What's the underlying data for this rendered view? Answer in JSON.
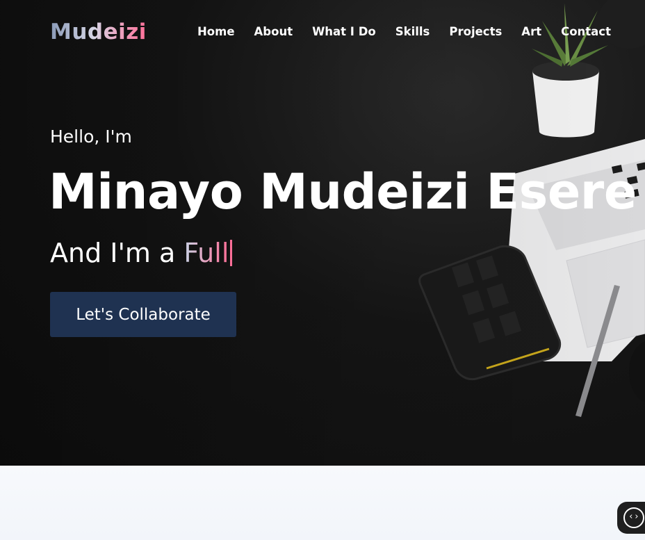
{
  "nav": {
    "logo": "Mudeizi",
    "items": [
      "Home",
      "About",
      "What I Do",
      "Skills",
      "Projects",
      "Art",
      "Contact"
    ]
  },
  "hero": {
    "greeting": "Hello, I'm",
    "name": "Minayo Mudeizi Esere",
    "role_prefix": "And I'm a ",
    "role_typed": "Full",
    "cta": "Let's Collaborate"
  },
  "icons": {
    "code_search": "code-search-icon"
  },
  "colors": {
    "button_bg": "#1f3251",
    "accent_pink": "#ff6f98",
    "hero_bg": "#151515"
  }
}
